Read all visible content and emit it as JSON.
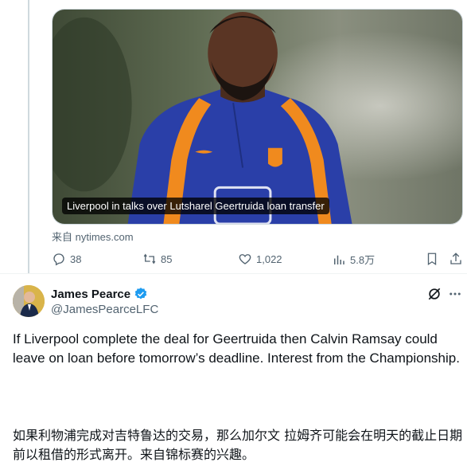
{
  "card": {
    "headline": "Liverpool in talks over Lutsharel Geertruida loan transfer",
    "source": "来自 nytimes.com"
  },
  "actions": {
    "replies": "38",
    "reposts": "85",
    "likes": "1,022",
    "views": "5.8万"
  },
  "author": {
    "display_name": "James Pearce",
    "handle": "@JamesPearceLFC",
    "verified": true
  },
  "tweet": {
    "text_en": "If Liverpool complete the deal for Geertruida then Calvin Ramsay could leave on loan before tomorrow’s deadline. Interest from the Championship.",
    "text_zh": "如果利物浦完成对吉特鲁达的交易，那么加尔文 拉姆齐可能会在明天的截止日期前以租借的形式离开。来自锦标赛的兴趣。"
  },
  "colors": {
    "accent": "#1d9bf0",
    "muted": "#536471",
    "text": "#0f1419",
    "divider": "#eff3f4"
  },
  "icons": [
    "reply-icon",
    "repost-icon",
    "like-icon",
    "views-icon",
    "bookmark-icon",
    "share-icon",
    "verified-icon",
    "grok-icon",
    "more-icon"
  ]
}
